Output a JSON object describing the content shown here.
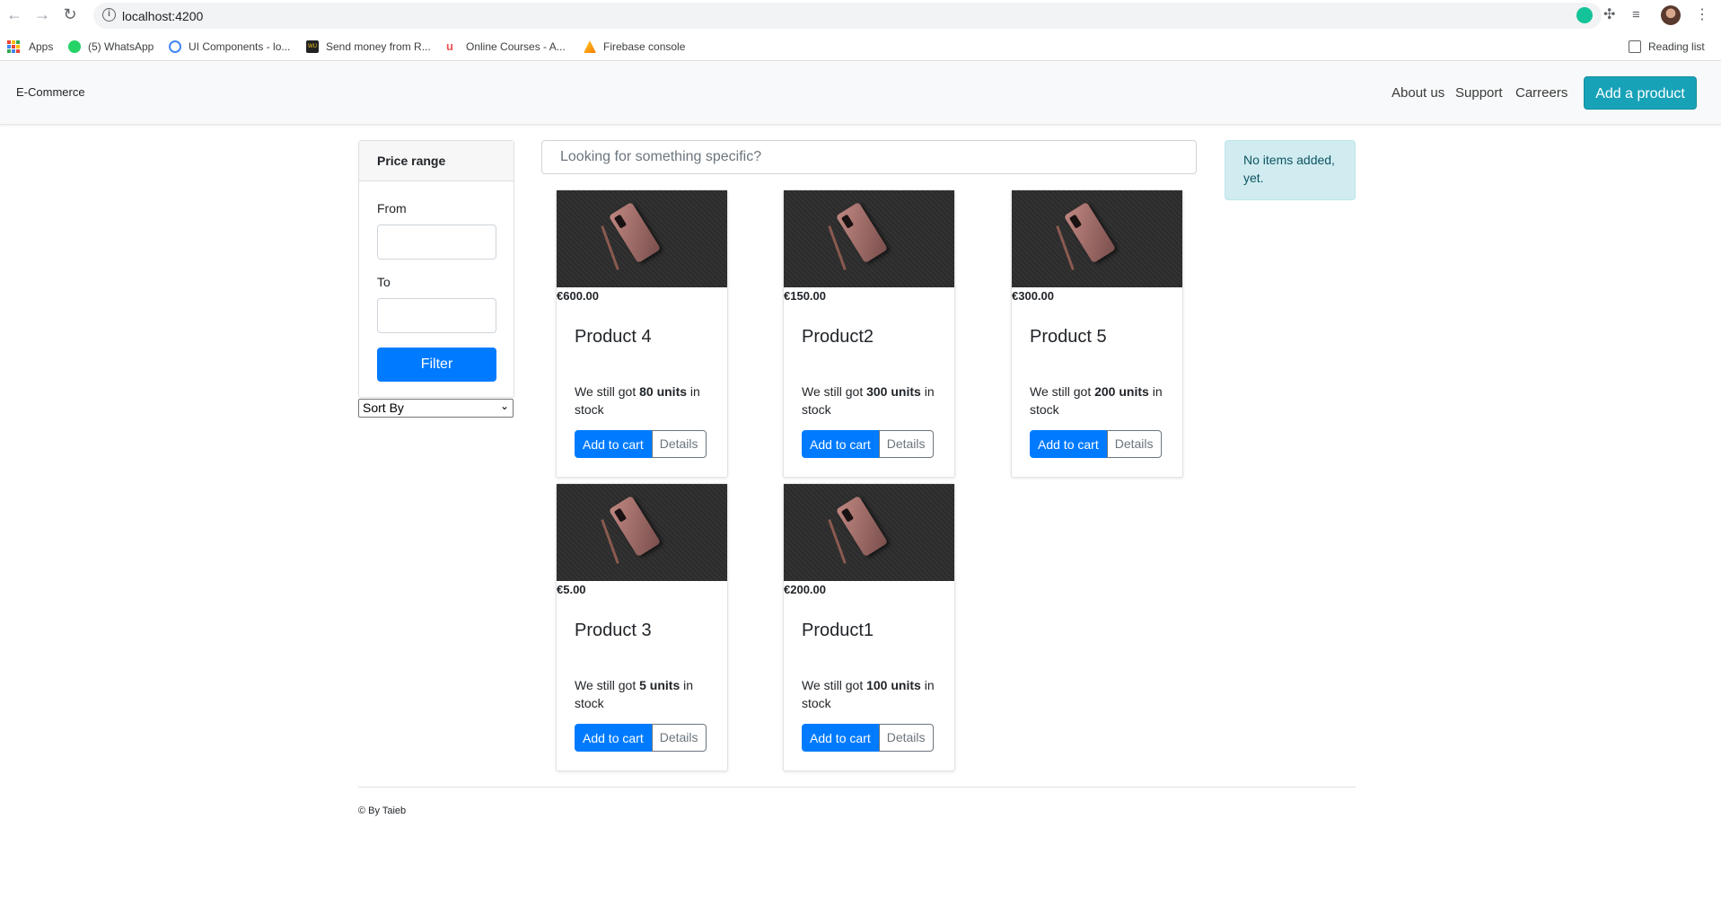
{
  "browser": {
    "url": "localhost:4200",
    "bookmarks": [
      {
        "label": "Apps"
      },
      {
        "label": "(5) WhatsApp"
      },
      {
        "label": "UI Components - lo..."
      },
      {
        "label": "Send money from R..."
      },
      {
        "label": "Online Courses - A..."
      },
      {
        "label": "Firebase console"
      }
    ],
    "reading_list": "Reading list"
  },
  "navbar": {
    "brand": "E-Commerce",
    "links": [
      "About us",
      "Support",
      "Carreers"
    ],
    "add_product": "Add a product"
  },
  "filter": {
    "title": "Price range",
    "from_label": "From",
    "to_label": "To",
    "from_value": "",
    "to_value": "",
    "button": "Filter",
    "sort_selected": "Sort By"
  },
  "search": {
    "placeholder": "Looking for something specific?"
  },
  "products": [
    {
      "price": "€600.00",
      "name": "Product 4",
      "stock_prefix": "We still got ",
      "stock_units": "80 units",
      "stock_suffix": " in stock",
      "add_label": "Add to cart",
      "details_label": "Details"
    },
    {
      "price": "€150.00",
      "name": "Product2",
      "stock_prefix": "We still got ",
      "stock_units": "300 units",
      "stock_suffix": " in stock",
      "add_label": "Add to cart",
      "details_label": "Details"
    },
    {
      "price": "€300.00",
      "name": "Product 5",
      "stock_prefix": "We still got ",
      "stock_units": "200 units",
      "stock_suffix": " in stock",
      "add_label": "Add to cart",
      "details_label": "Details"
    },
    {
      "price": "€5.00",
      "name": "Product 3",
      "stock_prefix": "We still got ",
      "stock_units": "5 units",
      "stock_suffix": " in stock",
      "add_label": "Add to cart",
      "details_label": "Details"
    },
    {
      "price": "€200.00",
      "name": "Product1",
      "stock_prefix": "We still got ",
      "stock_units": "100 units",
      "stock_suffix": " in stock",
      "add_label": "Add to cart",
      "details_label": "Details"
    }
  ],
  "cart": {
    "message": "No items added, yet."
  },
  "footer": {
    "text": "© By Taieb"
  },
  "colors": {
    "primary": "#007bff",
    "info": "#17a2b8",
    "alert_bg": "#d1ecf1",
    "alert_text": "#0c5460"
  }
}
